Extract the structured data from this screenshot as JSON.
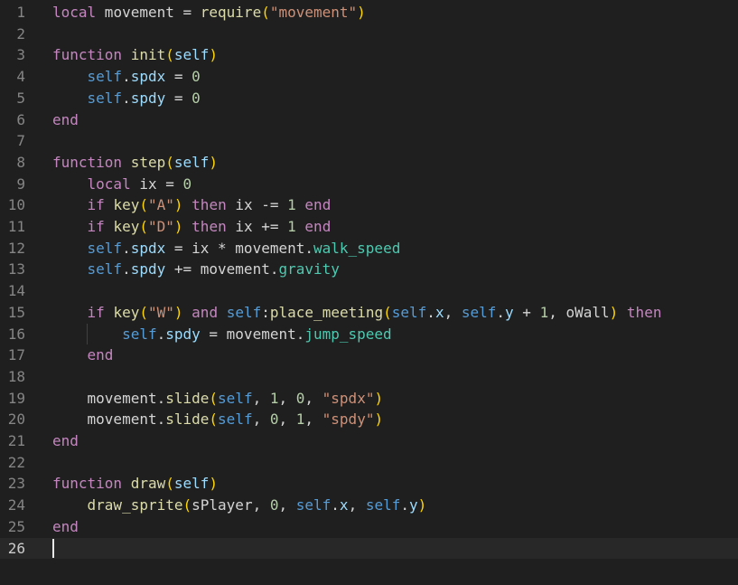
{
  "editor": {
    "active_line": 26,
    "lines": [
      {
        "n": "1",
        "tokens": [
          [
            "kw",
            "local"
          ],
          [
            "tx",
            " movement = "
          ],
          [
            "fn",
            "require"
          ],
          [
            "b1",
            "("
          ],
          [
            "str",
            "\"movement\""
          ],
          [
            "b1",
            ")"
          ]
        ]
      },
      {
        "n": "2",
        "tokens": []
      },
      {
        "n": "3",
        "tokens": [
          [
            "kw",
            "function"
          ],
          [
            "tx",
            " "
          ],
          [
            "fn",
            "init"
          ],
          [
            "b1",
            "("
          ],
          [
            "var",
            "self"
          ],
          [
            "b1",
            ")"
          ]
        ]
      },
      {
        "n": "4",
        "tokens": [
          [
            "tx",
            "    "
          ],
          [
            "self",
            "self"
          ],
          [
            "tx",
            "."
          ],
          [
            "var",
            "spdx"
          ],
          [
            "tx",
            " = "
          ],
          [
            "num",
            "0"
          ]
        ]
      },
      {
        "n": "5",
        "tokens": [
          [
            "tx",
            "    "
          ],
          [
            "self",
            "self"
          ],
          [
            "tx",
            "."
          ],
          [
            "var",
            "spdy"
          ],
          [
            "tx",
            " = "
          ],
          [
            "num",
            "0"
          ]
        ]
      },
      {
        "n": "6",
        "tokens": [
          [
            "kw",
            "end"
          ]
        ]
      },
      {
        "n": "7",
        "tokens": []
      },
      {
        "n": "8",
        "tokens": [
          [
            "kw",
            "function"
          ],
          [
            "tx",
            " "
          ],
          [
            "fn",
            "step"
          ],
          [
            "b1",
            "("
          ],
          [
            "var",
            "self"
          ],
          [
            "b1",
            ")"
          ]
        ]
      },
      {
        "n": "9",
        "tokens": [
          [
            "tx",
            "    "
          ],
          [
            "kw",
            "local"
          ],
          [
            "tx",
            " ix = "
          ],
          [
            "num",
            "0"
          ]
        ]
      },
      {
        "n": "10",
        "tokens": [
          [
            "tx",
            "    "
          ],
          [
            "kw",
            "if"
          ],
          [
            "tx",
            " "
          ],
          [
            "fn",
            "key"
          ],
          [
            "b1",
            "("
          ],
          [
            "str",
            "\"A\""
          ],
          [
            "b1",
            ")"
          ],
          [
            "tx",
            " "
          ],
          [
            "kw",
            "then"
          ],
          [
            "tx",
            " ix -= "
          ],
          [
            "num",
            "1"
          ],
          [
            "tx",
            " "
          ],
          [
            "kw",
            "end"
          ]
        ]
      },
      {
        "n": "11",
        "tokens": [
          [
            "tx",
            "    "
          ],
          [
            "kw",
            "if"
          ],
          [
            "tx",
            " "
          ],
          [
            "fn",
            "key"
          ],
          [
            "b1",
            "("
          ],
          [
            "str",
            "\"D\""
          ],
          [
            "b1",
            ")"
          ],
          [
            "tx",
            " "
          ],
          [
            "kw",
            "then"
          ],
          [
            "tx",
            " ix += "
          ],
          [
            "num",
            "1"
          ],
          [
            "tx",
            " "
          ],
          [
            "kw",
            "end"
          ]
        ]
      },
      {
        "n": "12",
        "tokens": [
          [
            "tx",
            "    "
          ],
          [
            "self",
            "self"
          ],
          [
            "tx",
            "."
          ],
          [
            "var",
            "spdx"
          ],
          [
            "tx",
            " = ix * movement."
          ],
          [
            "prop",
            "walk_speed"
          ]
        ]
      },
      {
        "n": "13",
        "tokens": [
          [
            "tx",
            "    "
          ],
          [
            "self",
            "self"
          ],
          [
            "tx",
            "."
          ],
          [
            "var",
            "spdy"
          ],
          [
            "tx",
            " += movement."
          ],
          [
            "prop",
            "gravity"
          ]
        ]
      },
      {
        "n": "14",
        "tokens": []
      },
      {
        "n": "15",
        "tokens": [
          [
            "tx",
            "    "
          ],
          [
            "kw",
            "if"
          ],
          [
            "tx",
            " "
          ],
          [
            "fn",
            "key"
          ],
          [
            "b1",
            "("
          ],
          [
            "str",
            "\"W\""
          ],
          [
            "b1",
            ")"
          ],
          [
            "tx",
            " "
          ],
          [
            "kw",
            "and"
          ],
          [
            "tx",
            " "
          ],
          [
            "self",
            "self"
          ],
          [
            "tx",
            ":"
          ],
          [
            "fn",
            "place_meeting"
          ],
          [
            "b1",
            "("
          ],
          [
            "self",
            "self"
          ],
          [
            "tx",
            "."
          ],
          [
            "var",
            "x"
          ],
          [
            "tx",
            ", "
          ],
          [
            "self",
            "self"
          ],
          [
            "tx",
            "."
          ],
          [
            "var",
            "y"
          ],
          [
            "tx",
            " + "
          ],
          [
            "num",
            "1"
          ],
          [
            "tx",
            ", oWall"
          ],
          [
            "b1",
            ")"
          ],
          [
            "tx",
            " "
          ],
          [
            "kw",
            "then"
          ]
        ]
      },
      {
        "n": "16",
        "tokens": [
          [
            "tx",
            "        "
          ],
          [
            "self",
            "self"
          ],
          [
            "tx",
            "."
          ],
          [
            "var",
            "spdy"
          ],
          [
            "tx",
            " = movement."
          ],
          [
            "prop",
            "jump_speed"
          ]
        ]
      },
      {
        "n": "17",
        "tokens": [
          [
            "tx",
            "    "
          ],
          [
            "kw",
            "end"
          ]
        ]
      },
      {
        "n": "18",
        "tokens": []
      },
      {
        "n": "19",
        "tokens": [
          [
            "tx",
            "    movement."
          ],
          [
            "fn",
            "slide"
          ],
          [
            "b1",
            "("
          ],
          [
            "self",
            "self"
          ],
          [
            "tx",
            ", "
          ],
          [
            "num",
            "1"
          ],
          [
            "tx",
            ", "
          ],
          [
            "num",
            "0"
          ],
          [
            "tx",
            ", "
          ],
          [
            "str",
            "\"spdx\""
          ],
          [
            "b1",
            ")"
          ]
        ]
      },
      {
        "n": "20",
        "tokens": [
          [
            "tx",
            "    movement."
          ],
          [
            "fn",
            "slide"
          ],
          [
            "b1",
            "("
          ],
          [
            "self",
            "self"
          ],
          [
            "tx",
            ", "
          ],
          [
            "num",
            "0"
          ],
          [
            "tx",
            ", "
          ],
          [
            "num",
            "1"
          ],
          [
            "tx",
            ", "
          ],
          [
            "str",
            "\"spdy\""
          ],
          [
            "b1",
            ")"
          ]
        ]
      },
      {
        "n": "21",
        "tokens": [
          [
            "kw",
            "end"
          ]
        ]
      },
      {
        "n": "22",
        "tokens": []
      },
      {
        "n": "23",
        "tokens": [
          [
            "kw",
            "function"
          ],
          [
            "tx",
            " "
          ],
          [
            "fn",
            "draw"
          ],
          [
            "b1",
            "("
          ],
          [
            "var",
            "self"
          ],
          [
            "b1",
            ")"
          ]
        ]
      },
      {
        "n": "24",
        "tokens": [
          [
            "tx",
            "    "
          ],
          [
            "fn",
            "draw_sprite"
          ],
          [
            "b1",
            "("
          ],
          [
            "tx",
            "sPlayer, "
          ],
          [
            "num",
            "0"
          ],
          [
            "tx",
            ", "
          ],
          [
            "self",
            "self"
          ],
          [
            "tx",
            "."
          ],
          [
            "var",
            "x"
          ],
          [
            "tx",
            ", "
          ],
          [
            "self",
            "self"
          ],
          [
            "tx",
            "."
          ],
          [
            "var",
            "y"
          ],
          [
            "b1",
            ")"
          ]
        ]
      },
      {
        "n": "25",
        "tokens": [
          [
            "kw",
            "end"
          ]
        ]
      },
      {
        "n": "26",
        "tokens": []
      }
    ]
  },
  "colors": {
    "background": "#1f1f1f",
    "active_line": "#282828",
    "keyword": "#c586c0",
    "function": "#dcdcaa",
    "string": "#ce9178",
    "number": "#b5cea8",
    "self": "#569cd6",
    "property": "#4ec9b0"
  }
}
